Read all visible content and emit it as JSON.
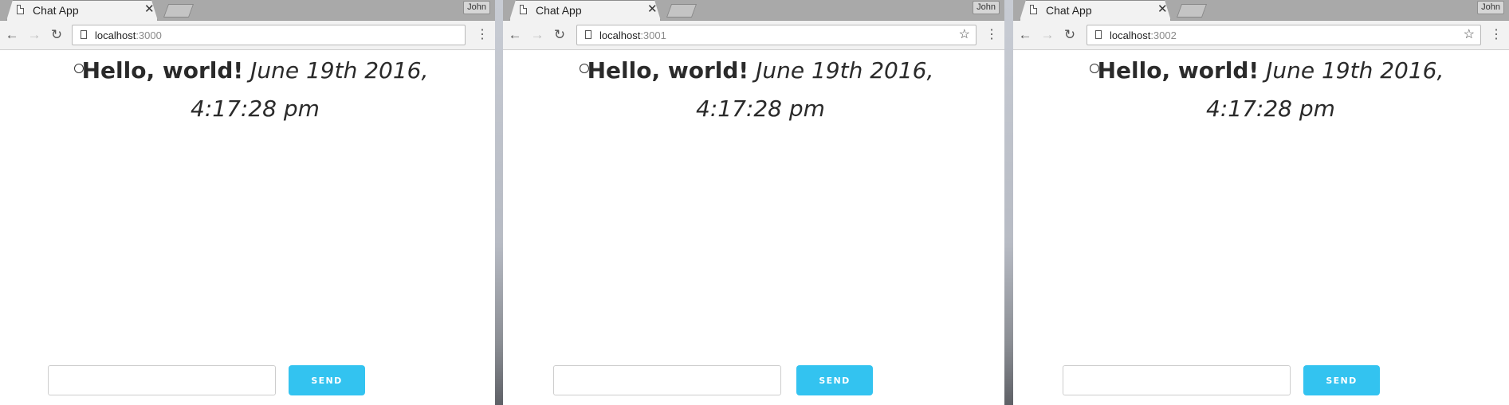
{
  "windows": [
    {
      "tab_title": "Chat App",
      "profile": "John",
      "url_host": "localhost",
      "url_port": ":3000",
      "message": {
        "text": "Hello, world!",
        "time": "June 19th 2016, 4:17:28 pm"
      },
      "send_label": "SEND",
      "input_value": ""
    },
    {
      "tab_title": "Chat App",
      "profile": "John",
      "url_host": "localhost",
      "url_port": ":3001",
      "message": {
        "text": "Hello, world!",
        "time": "June 19th 2016, 4:17:28 pm"
      },
      "send_label": "SEND",
      "input_value": ""
    },
    {
      "tab_title": "Chat App",
      "profile": "John",
      "url_host": "localhost",
      "url_port": ":3002",
      "message": {
        "text": "Hello, world!",
        "time": "June 19th 2016, 4:17:28 pm"
      },
      "send_label": "SEND",
      "input_value": ""
    }
  ],
  "icons": {
    "back": "back-arrow-icon",
    "forward": "forward-arrow-icon",
    "reload": "reload-icon",
    "page": "page-icon",
    "star": "star-icon",
    "menu": "menu-dots-icon",
    "close": "close-icon"
  },
  "colors": {
    "send_button": "#33c3f0",
    "tab_strip": "#a9a9a9",
    "toolbar": "#f2f2f2"
  }
}
